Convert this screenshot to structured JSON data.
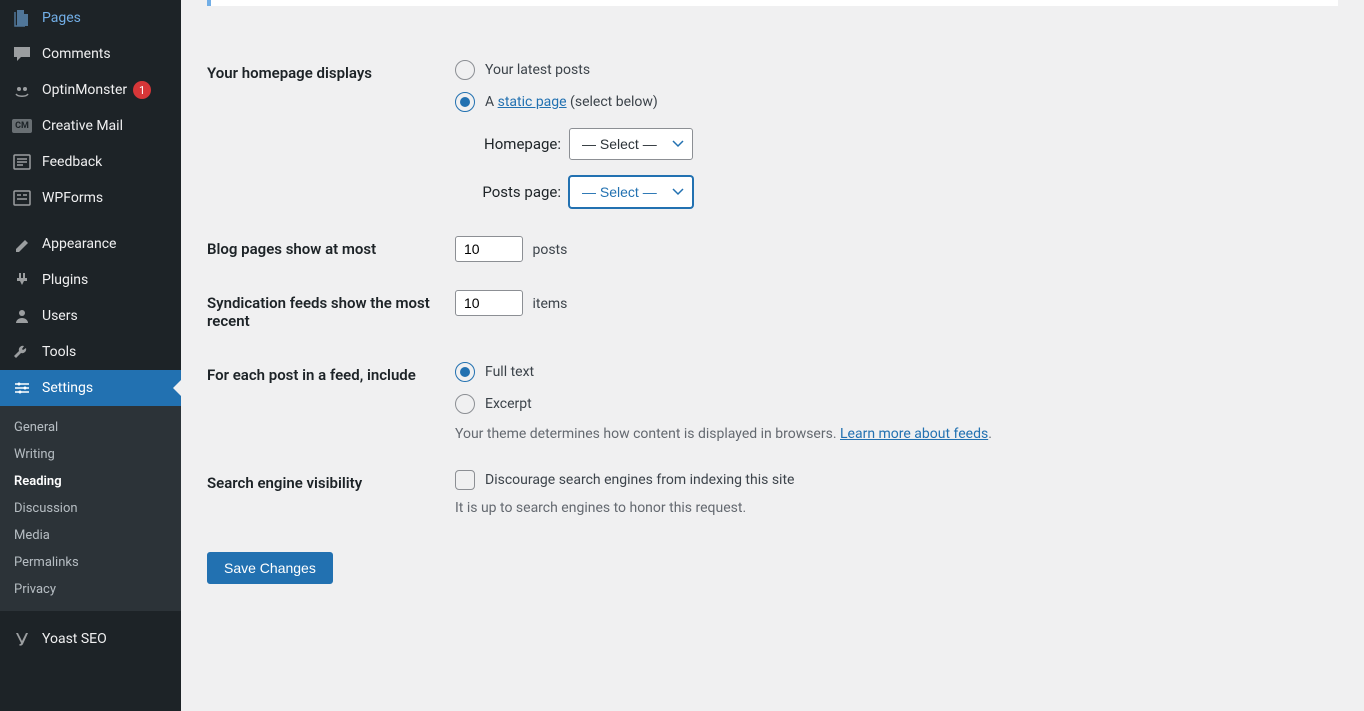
{
  "sidebar": {
    "items": [
      {
        "label": "Pages"
      },
      {
        "label": "Comments"
      },
      {
        "label": "OptinMonster",
        "badge": "1"
      },
      {
        "label": "Creative Mail"
      },
      {
        "label": "Feedback"
      },
      {
        "label": "WPForms"
      },
      {
        "label": "Appearance"
      },
      {
        "label": "Plugins"
      },
      {
        "label": "Users"
      },
      {
        "label": "Tools"
      },
      {
        "label": "Settings"
      },
      {
        "label": "Yoast SEO"
      }
    ],
    "submenu": [
      {
        "label": "General"
      },
      {
        "label": "Writing"
      },
      {
        "label": "Reading"
      },
      {
        "label": "Discussion"
      },
      {
        "label": "Media"
      },
      {
        "label": "Permalinks"
      },
      {
        "label": "Privacy"
      }
    ]
  },
  "form": {
    "homepage_displays": {
      "label": "Your homepage displays",
      "opt_latest": "Your latest posts",
      "opt_static_prefix": "A ",
      "opt_static_link": "static page",
      "opt_static_suffix": " (select below)",
      "homepage_label": "Homepage:",
      "postspage_label": "Posts page:",
      "select_placeholder": "— Select —"
    },
    "blog_pages": {
      "label": "Blog pages show at most",
      "value": "10",
      "suffix": "posts"
    },
    "syndication": {
      "label": "Syndication feeds show the most recent",
      "value": "10",
      "suffix": "items"
    },
    "feed_include": {
      "label": "For each post in a feed, include",
      "opt_full": "Full text",
      "opt_excerpt": "Excerpt",
      "desc_prefix": "Your theme determines how content is displayed in browsers. ",
      "desc_link": "Learn more about feeds",
      "desc_suffix": "."
    },
    "search_visibility": {
      "label": "Search engine visibility",
      "checkbox_label": "Discourage search engines from indexing this site",
      "desc": "It is up to search engines to honor this request."
    },
    "submit_label": "Save Changes"
  }
}
